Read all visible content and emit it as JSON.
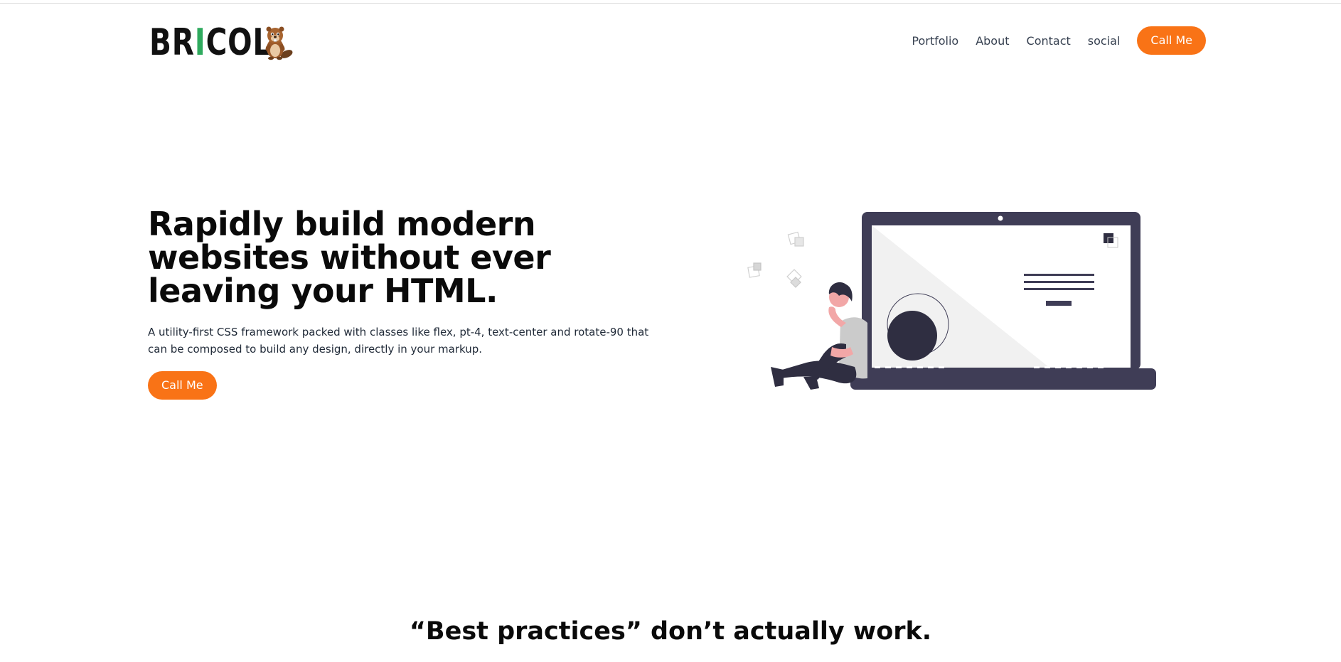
{
  "logo": {
    "text_before": "BR",
    "text_i": "I",
    "text_after": "COL",
    "wrench_color": "#2faa5e",
    "mascot_icon": "beaver-icon"
  },
  "nav": {
    "items": [
      {
        "label": "Portfolio"
      },
      {
        "label": "About"
      },
      {
        "label": "Contact"
      },
      {
        "label": "social"
      }
    ],
    "cta_label": "Call Me"
  },
  "hero": {
    "title": "Rapidly build modern websites without ever leaving your HTML.",
    "description": "A utility-first CSS framework packed with classes like flex, pt-4, text-center and rotate-90 that can be composed to build any design, directly in your markup.",
    "cta_label": "Call Me",
    "illustration_icon": "person-with-laptop-illustration"
  },
  "section": {
    "title": "“Best practices” don’t actually work.",
    "subtitle": ""
  },
  "colors": {
    "accent": "#f97316",
    "text": "#0a0a0a",
    "laptop": "#3f3d56",
    "laptop_circle": "#2f2e41"
  }
}
